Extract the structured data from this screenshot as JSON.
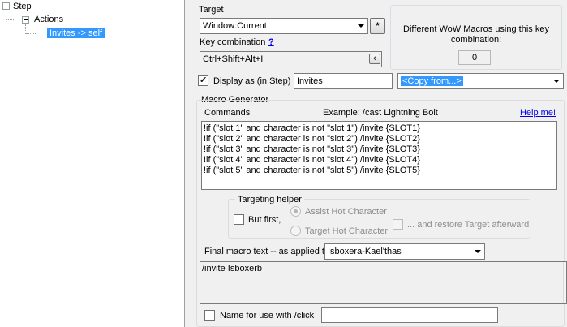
{
  "tree": {
    "root_label": "Step",
    "child_label": "Actions",
    "selected_label": "Invites -> self"
  },
  "target": {
    "group_label": "Target",
    "combo_value": "Window:Current",
    "star_button": "*",
    "key_combo_label": "Key combination",
    "help_mark": "?",
    "key_combo_value": "Ctrl+Shift+Alt+I",
    "key_combo_button": "‹"
  },
  "wow_macros": {
    "label": "Different WoW Macros using this key combination:",
    "count": "0"
  },
  "display": {
    "checkbox_checked": true,
    "label": "Display as (in Step)",
    "value": "Invites",
    "copy_from": "<Copy from...>"
  },
  "macro_generator": {
    "group_label": "Macro Generator",
    "commands_label": "Commands",
    "example_label": "Example: /cast Lightning Bolt",
    "help_link": "Help me!",
    "lines": [
      "!if (\"slot 1\" and character is not \"slot 1\") /invite {SLOT1}",
      "!if (\"slot 2\" and character is not \"slot 2\") /invite {SLOT2}",
      "!if (\"slot 3\" and character is not \"slot 3\") /invite {SLOT3}",
      "!if (\"slot 4\" and character is not \"slot 4\") /invite {SLOT4}",
      "!if (\"slot 5\" and character is not \"slot 5\") /invite {SLOT5}"
    ]
  },
  "targeting_helper": {
    "group_label": "Targeting helper",
    "but_first_label": "But first,",
    "but_first_checked": false,
    "assist_label": "Assist Hot Character",
    "target_label": "Target Hot Character",
    "restore_label": "... and restore Target afterward"
  },
  "final_macro": {
    "label": "Final macro text -- as applied to",
    "character": "Isboxera-Kael'thas",
    "text": "/invite Isboxerb"
  },
  "click_name": {
    "label": "Name for use with /click",
    "checked": false,
    "value": ""
  }
}
